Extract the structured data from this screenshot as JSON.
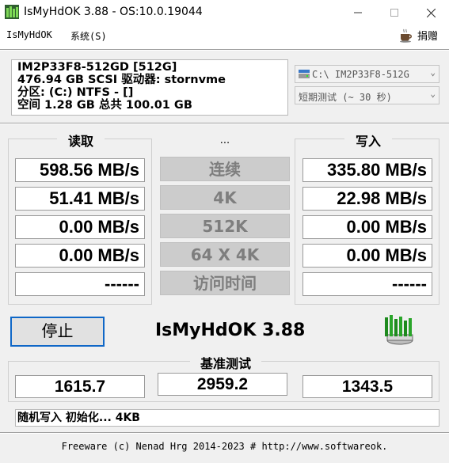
{
  "window": {
    "title": "IsMyHdOK 3.88 - OS:10.0.19044"
  },
  "menu": {
    "items": [
      "IsMyHdOK",
      "系统(S)"
    ],
    "donate": "捐赠"
  },
  "drive_info": {
    "lines": [
      "IM2P33F8-512GD [512G]",
      "476.94 GB  SCSI 驱动器: stornvme",
      "分区: (C:) NTFS - []",
      "空间 1.28 GB 总共 100.01 GB"
    ]
  },
  "drive_select": {
    "value": "C:\\ IM2P33F8-512G"
  },
  "duration_select": {
    "value": "短期测试 (~ 30 秒)"
  },
  "read": {
    "label": "读取",
    "values": [
      "598.56 MB/s",
      "51.41 MB/s",
      "0.00 MB/s",
      "0.00 MB/s",
      "------"
    ]
  },
  "write": {
    "label": "写入",
    "values": [
      "335.80 MB/s",
      "22.98 MB/s",
      "0.00 MB/s",
      "0.00 MB/s",
      "------"
    ]
  },
  "middle": {
    "label": "...",
    "buttons": [
      "连续",
      "4K",
      "512K",
      "64 X 4K",
      "访问时间"
    ]
  },
  "stop_label": "停止",
  "app_name": "IsMyHdOK 3.88",
  "benchmark": {
    "label": "基准测试",
    "values": [
      "1615.7",
      "2959.2",
      "1343.5"
    ]
  },
  "status": "随机写入 初始化... 4KB",
  "footer": "Freeware (c) Nenad Hrg 2014-2023 # http://www.softwareok.",
  "colors": {
    "accent": "#0f67c7",
    "disabled_button": "#cccccc",
    "disabled_text": "#7e7e7e"
  }
}
